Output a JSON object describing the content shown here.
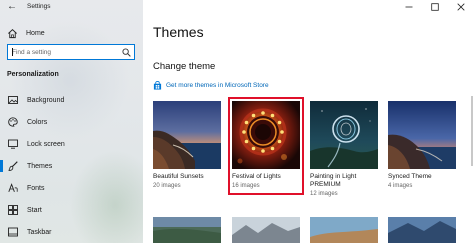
{
  "window": {
    "title": "Settings",
    "controls": {
      "minimize": "minimize-icon",
      "maximize": "maximize-icon",
      "close": "close-icon"
    }
  },
  "sidebar": {
    "home_label": "Home",
    "search": {
      "placeholder": "Find a setting",
      "value": ""
    },
    "section_label": "Personalization",
    "items": [
      {
        "label": "Background",
        "icon": "background-image-icon",
        "active": false
      },
      {
        "label": "Colors",
        "icon": "palette-icon",
        "active": false
      },
      {
        "label": "Lock screen",
        "icon": "lock-screen-icon",
        "active": false
      },
      {
        "label": "Themes",
        "icon": "themes-brush-icon",
        "active": true
      },
      {
        "label": "Fonts",
        "icon": "fonts-icon",
        "active": false
      },
      {
        "label": "Start",
        "icon": "start-menu-icon",
        "active": false
      },
      {
        "label": "Taskbar",
        "icon": "taskbar-icon",
        "active": false
      }
    ]
  },
  "main": {
    "title": "Themes",
    "subtitle": "Change theme",
    "store_link": "Get more themes in Microsoft Store",
    "themes": [
      {
        "name": "Beautiful Sunsets",
        "name2": "",
        "count": "20 images",
        "selected": false
      },
      {
        "name": "Festival of Lights",
        "name2": "",
        "count": "16 images",
        "selected": true
      },
      {
        "name": "Painting in Light",
        "name2": "PREMIUM",
        "count": "12 images",
        "selected": false
      },
      {
        "name": "Synced Theme",
        "name2": "",
        "count": "4 images",
        "selected": false
      }
    ]
  },
  "colors": {
    "accent": "#0078d7",
    "selection_highlight": "#e0102a",
    "link": "#0067b8"
  }
}
